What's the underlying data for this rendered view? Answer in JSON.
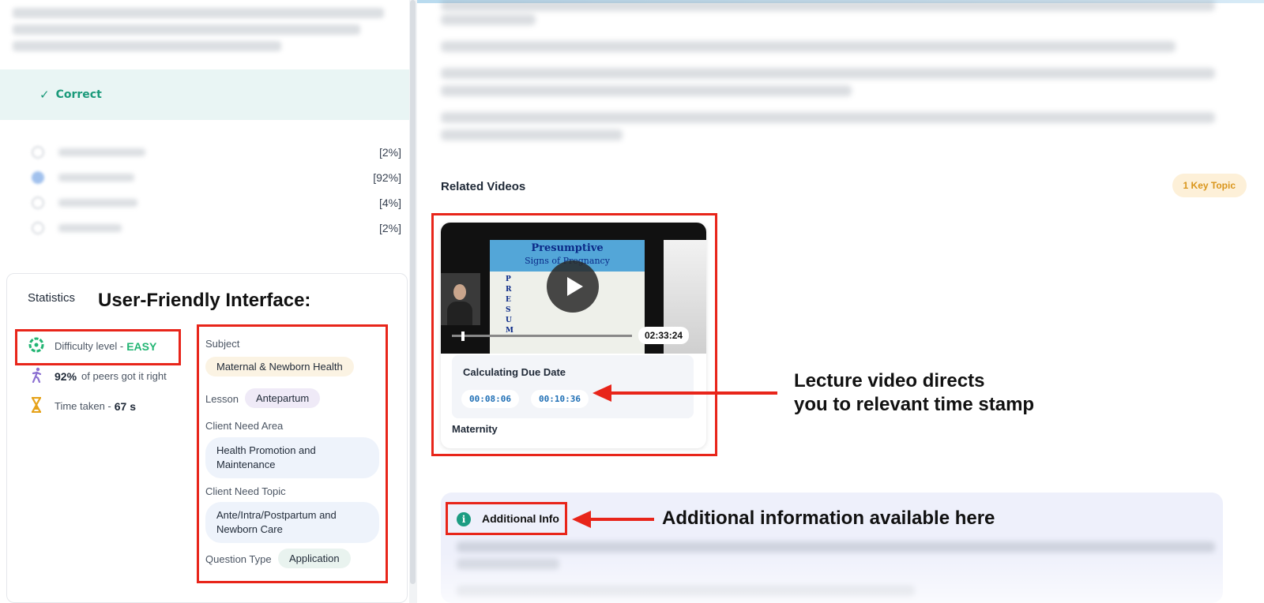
{
  "question_result": {
    "status_label": "Correct"
  },
  "answer_options": [
    {
      "percent": "[2%]",
      "selected": false
    },
    {
      "percent": "[92%]",
      "selected": true
    },
    {
      "percent": "[4%]",
      "selected": false
    },
    {
      "percent": "[2%]",
      "selected": false
    }
  ],
  "statistics": {
    "title": "Statistics",
    "annotation": "User-Friendly Interface:",
    "difficulty_label": "Difficulty level - ",
    "difficulty_value": "EASY",
    "peers_percent": "92%",
    "peers_label": "of peers got it right",
    "time_label": "Time taken - ",
    "time_value": "67 s"
  },
  "meta": {
    "subject_label": "Subject",
    "subject_value": "Maternal & Newborn Health",
    "lesson_label": "Lesson",
    "lesson_value": "Antepartum",
    "client_need_area_label": "Client Need Area",
    "client_need_area_line1": "Health Promotion and",
    "client_need_area_line2": "Maintenance",
    "client_need_topic_label": "Client Need Topic",
    "client_need_topic_line1": "Ante/Intra/Postpartum and",
    "client_need_topic_line2": "Newborn Care",
    "question_type_label": "Question Type",
    "question_type_value": "Application"
  },
  "related_videos": {
    "title": "Related Videos",
    "key_topic_badge": "1 Key Topic",
    "video": {
      "slide_title": "Presumptive",
      "slide_subtitle": "Signs of Pregnancy",
      "slide_letters": "P\nR\nE\nS\nU\nM",
      "duration": "02:33:24",
      "title": "Calculating Due Date",
      "timestamp_1": "00:08:06",
      "timestamp_2": "00:10:36",
      "category": "Maternity"
    }
  },
  "annotations": {
    "video_line1": "Lecture video directs",
    "video_line2": "you to relevant time stamp",
    "additional": "Additional information available here"
  },
  "additional_info": {
    "label": "Additional Info"
  },
  "colors": {
    "accent_red": "#e8251a",
    "correct_green": "#1a9a7a",
    "easy_green": "#22b573",
    "badge_orange": "#d9951b"
  }
}
